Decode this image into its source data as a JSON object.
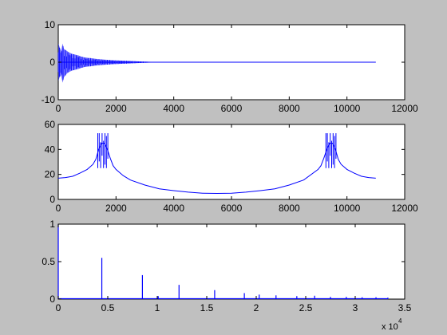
{
  "figure": {
    "background": "#c0c0c0",
    "axes_background": "#ffffff",
    "line_color": "#0000ff"
  },
  "chart_data": [
    {
      "type": "line",
      "title": "",
      "xlabel": "",
      "ylabel": "",
      "xlim": [
        0,
        12000
      ],
      "ylim": [
        -10,
        10
      ],
      "xticks": [
        "0",
        "2000",
        "4000",
        "6000",
        "8000",
        "10000",
        "12000"
      ],
      "yticks": [
        "-10",
        "0",
        "10"
      ],
      "grid": false,
      "series": [
        {
          "x": [
            0,
            50,
            100,
            150,
            200,
            300,
            400,
            500,
            600,
            700,
            800,
            900,
            1000,
            1200,
            1400,
            1600,
            1800,
            2000,
            2300,
            2600,
            2900,
            3200,
            3500,
            11000
          ],
          "upper": [
            5,
            4,
            3,
            5,
            3.5,
            3,
            2.5,
            2.2,
            2,
            1.8,
            1.5,
            1.3,
            1.2,
            1,
            0.8,
            0.7,
            0.6,
            0.5,
            0.4,
            0.3,
            0.2,
            0.1,
            0.02,
            0
          ],
          "lower": [
            -5,
            -4,
            -3.5,
            -5.5,
            -4,
            -3,
            -2.5,
            -2.2,
            -2,
            -1.8,
            -1.5,
            -1.3,
            -1.2,
            -1,
            -0.8,
            -0.7,
            -0.6,
            -0.5,
            -0.4,
            -0.3,
            -0.2,
            -0.1,
            -0.02,
            0
          ]
        }
      ]
    },
    {
      "type": "line",
      "title": "",
      "xlabel": "",
      "ylabel": "",
      "xlim": [
        0,
        12000
      ],
      "ylim": [
        0,
        60
      ],
      "xticks": [
        "0",
        "2000",
        "4000",
        "6000",
        "8000",
        "10000",
        "12000"
      ],
      "yticks": [
        "0",
        "20",
        "40",
        "60"
      ],
      "grid": false,
      "series": [
        {
          "x": [
            0,
            250,
            500,
            750,
            1000,
            1200,
            1300,
            1400,
            1500,
            1600,
            1700,
            1800,
            1900,
            2000,
            2250,
            2500,
            3000,
            3500,
            4000,
            4500,
            5000,
            5500,
            6000,
            6500,
            7000,
            7500,
            8000,
            8500,
            9000,
            9100,
            9200,
            9300,
            9400,
            9500,
            9600,
            9700,
            9800,
            10000,
            10250,
            10500,
            10750,
            11000
          ],
          "y": [
            17,
            17.5,
            18.5,
            21,
            24,
            28,
            32,
            40,
            45,
            45,
            40,
            33,
            27,
            24,
            19,
            15.5,
            11.5,
            8.5,
            7,
            5.8,
            5,
            4.8,
            5,
            5.8,
            7,
            8.5,
            11.5,
            15.5,
            24,
            27,
            33,
            40,
            45,
            45,
            40,
            32,
            28,
            24,
            21,
            18.5,
            17.5,
            17
          ]
        }
      ],
      "spikes": [
        {
          "center": 1550,
          "halfwidth": 180,
          "top": 53,
          "bottom": 25
        },
        {
          "center": 9450,
          "halfwidth": 180,
          "top": 53,
          "bottom": 25
        }
      ]
    },
    {
      "type": "bar",
      "title": "",
      "xlabel": "",
      "ylabel": "",
      "xlim": [
        0,
        35000
      ],
      "ylim": [
        0,
        1
      ],
      "xticks": [
        "0",
        "0.5",
        "1",
        "1.5",
        "2",
        "2.5",
        "3",
        "3.5"
      ],
      "yticks": [
        "0",
        "0.5",
        "1"
      ],
      "x_multiplier": {
        "base": "x 10",
        "exp": "4"
      },
      "grid": false,
      "stems": [
        {
          "x": 0,
          "y": 1.0
        },
        {
          "x": 4400,
          "y": 0.55
        },
        {
          "x": 8500,
          "y": 0.32
        },
        {
          "x": 10100,
          "y": 0.04
        },
        {
          "x": 12200,
          "y": 0.19
        },
        {
          "x": 15800,
          "y": 0.12
        },
        {
          "x": 18800,
          "y": 0.08
        },
        {
          "x": 20300,
          "y": 0.06
        },
        {
          "x": 22000,
          "y": 0.05
        },
        {
          "x": 24100,
          "y": 0.04
        },
        {
          "x": 25900,
          "y": 0.045
        },
        {
          "x": 27500,
          "y": 0.03
        },
        {
          "x": 29100,
          "y": 0.03
        },
        {
          "x": 30700,
          "y": 0.025
        },
        {
          "x": 32100,
          "y": 0.025
        },
        {
          "x": 33300,
          "y": 0.02
        }
      ]
    }
  ]
}
